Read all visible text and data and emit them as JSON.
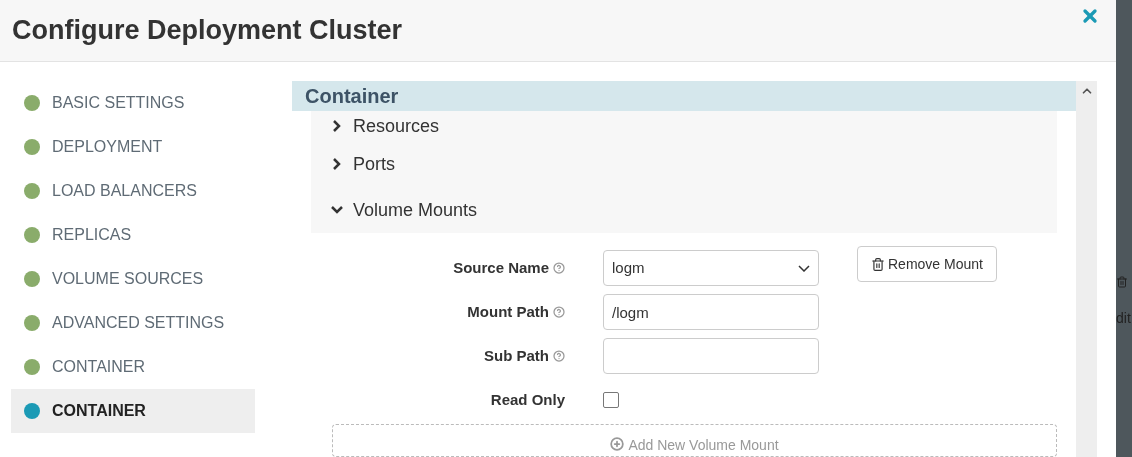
{
  "dialog": {
    "title": "Configure Deployment Cluster"
  },
  "sidebar": {
    "items": [
      {
        "label": "BASIC SETTINGS",
        "selected": false,
        "color": "#8aac6b"
      },
      {
        "label": "DEPLOYMENT",
        "selected": false,
        "color": "#8aac6b"
      },
      {
        "label": "LOAD BALANCERS",
        "selected": false,
        "color": "#8aac6b"
      },
      {
        "label": "REPLICAS",
        "selected": false,
        "color": "#8aac6b"
      },
      {
        "label": "VOLUME SOURCES",
        "selected": false,
        "color": "#8aac6b"
      },
      {
        "label": "ADVANCED SETTINGS",
        "selected": false,
        "color": "#8aac6b"
      },
      {
        "label": "CONTAINER",
        "selected": false,
        "color": "#8aac6b"
      },
      {
        "label": "CONTAINER",
        "selected": true,
        "color": "#1b9ab5"
      }
    ]
  },
  "panel": {
    "title": "Container",
    "sections": [
      {
        "label": "Resources",
        "expanded": false
      },
      {
        "label": "Ports",
        "expanded": false
      },
      {
        "label": "Volume Mounts",
        "expanded": true
      }
    ],
    "form": {
      "source_name": {
        "label": "Source Name",
        "value": "logm"
      },
      "mount_path": {
        "label": "Mount Path",
        "value": "/logm"
      },
      "sub_path": {
        "label": "Sub Path"
      },
      "read_only": {
        "label": "Read Only",
        "checked": false
      },
      "remove_button": "Remove Mount",
      "add_button": "Add New Volume Mount"
    }
  },
  "background_page": {
    "text": "dit"
  }
}
